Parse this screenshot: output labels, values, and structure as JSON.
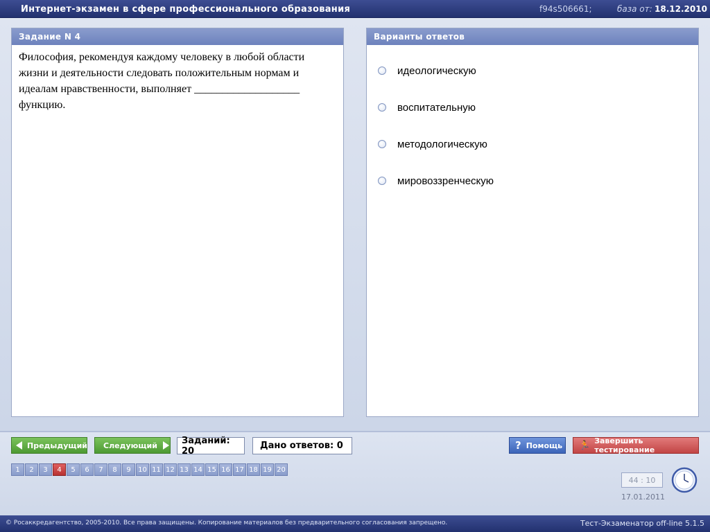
{
  "header": {
    "title": "Интернет-экзамен в сфере профессионального образования",
    "code": "f94s506661;",
    "base_label": "база от:",
    "base_date": "18.12.2010"
  },
  "task": {
    "heading": "Задание N 4",
    "question": "Философия, рекомендуя каждому человеку в любой области жизни и деятельности следовать положительным нормам и идеалам нравственности, выполняет ___________________ функцию."
  },
  "answers": {
    "heading": "Варианты ответов",
    "options": [
      "идеологическую",
      "воспитательную",
      "методологическую",
      "мировоззренческую"
    ]
  },
  "controls": {
    "prev_label": "Предыдущий",
    "next_label": "Следующий",
    "tasks_count": "Заданий: 20",
    "answers_given": "Дано ответов: 0",
    "help_label": "Помощь",
    "finish_label": "Завершить тестирование"
  },
  "pager": {
    "pages": [
      "1",
      "2",
      "3",
      "4",
      "5",
      "6",
      "7",
      "8",
      "9",
      "10",
      "11",
      "12",
      "13",
      "14",
      "15",
      "16",
      "17",
      "18",
      "19",
      "20"
    ],
    "active": 4
  },
  "status": {
    "timer": "44 : 10",
    "date": "17.01.2011"
  },
  "footer": {
    "copyright": "© Росаккредагентство, 2005-2010. Все права защищены. Копирование материалов без предварительного согласования запрещено.",
    "version": "Тест-Экзаменатор off-line 5.1.5"
  },
  "colors": {
    "header_bg": "#22316f",
    "panel_head": "#7a8ec5",
    "button_green": "#4d9a33",
    "button_blue": "#3c64b9",
    "button_red": "#c24545",
    "active_page": "#b83232"
  }
}
